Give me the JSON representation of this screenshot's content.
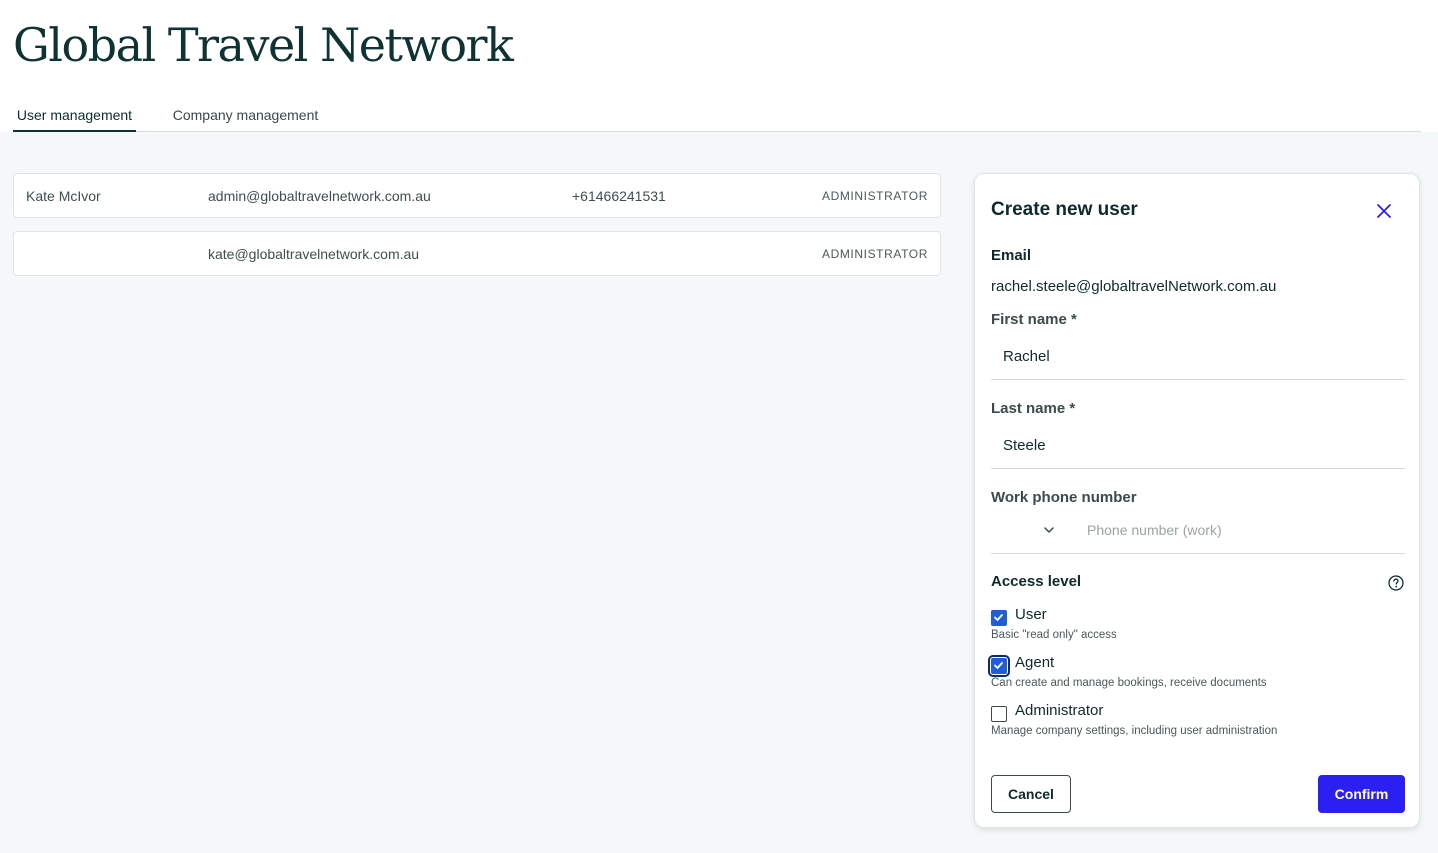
{
  "app": {
    "brand": "Global Travel Network"
  },
  "tabs": [
    {
      "label": "User management",
      "active": true
    },
    {
      "label": "Company management",
      "active": false
    }
  ],
  "users": [
    {
      "name": "Kate McIvor",
      "email": "admin@globaltravelnetwork.com.au",
      "phone": "+61466241531",
      "role": "ADMINISTRATOR"
    },
    {
      "name": "",
      "email": "kate@globaltravelnetwork.com.au",
      "phone": "",
      "role": "ADMINISTRATOR"
    }
  ],
  "panel": {
    "title": "Create new user",
    "email_label": "Email",
    "email_value": "rachel.steele@globaltravelNetwork.com.au",
    "first_name_label": "First name *",
    "first_name_value": "Rachel",
    "last_name_label": "Last name *",
    "last_name_value": "Steele",
    "phone_label": "Work phone number",
    "phone_placeholder": "Phone number (work)",
    "access_title": "Access level",
    "options": [
      {
        "label": "User",
        "desc": "Basic \"read only\" access",
        "checked": true
      },
      {
        "label": "Agent",
        "desc": "Can create and manage bookings, receive documents",
        "checked": true
      },
      {
        "label": "Administrator",
        "desc": "Manage company settings, including user administration",
        "checked": false
      }
    ],
    "cancel_label": "Cancel",
    "confirm_label": "Confirm"
  },
  "colors": {
    "accent": "#2b1ff2",
    "checkbox": "#1f5fd6",
    "brand_text": "#0f3232",
    "background": "#f4f8f8"
  },
  "icons": {
    "close": "close-icon",
    "dropdown": "chevron-down-icon",
    "help": "help-circle-icon",
    "check": "checkmark-icon"
  }
}
